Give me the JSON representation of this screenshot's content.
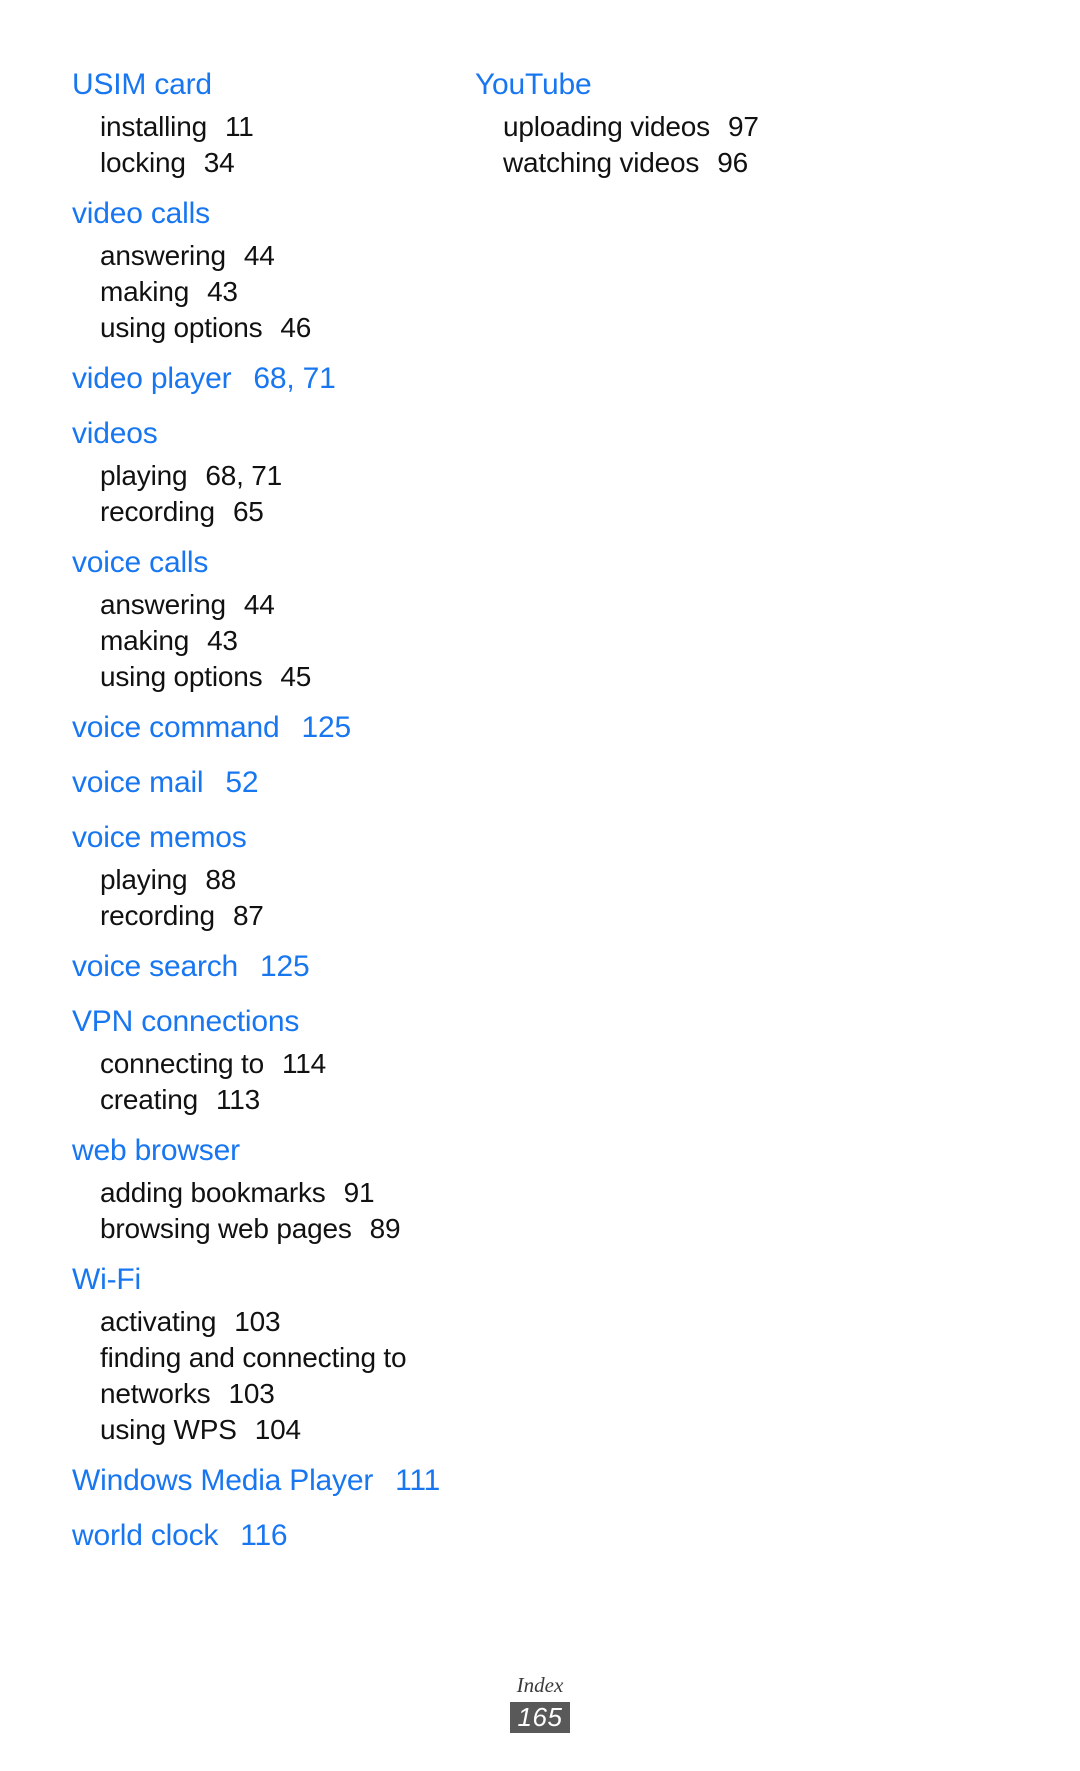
{
  "document": {
    "type": "index",
    "footer_label": "Index",
    "page_number": "165",
    "heading_color": "#1877f0",
    "text_color": "#111111",
    "badge_color": "#595959"
  },
  "columns": [
    {
      "name": "left-column",
      "groups": [
        {
          "head": "USIM card",
          "head_pages": "",
          "subentries": [
            {
              "label": "installing",
              "pages": "11"
            },
            {
              "label": "locking",
              "pages": "34"
            }
          ]
        },
        {
          "head": "video calls",
          "head_pages": "",
          "subentries": [
            {
              "label": "answering",
              "pages": "44"
            },
            {
              "label": "making",
              "pages": "43"
            },
            {
              "label": "using options",
              "pages": "46"
            }
          ]
        },
        {
          "head": "video player",
          "head_pages": "68, 71",
          "subentries": []
        },
        {
          "head": "videos",
          "head_pages": "",
          "subentries": [
            {
              "label": "playing",
              "pages": "68, 71"
            },
            {
              "label": "recording",
              "pages": "65"
            }
          ]
        },
        {
          "head": "voice calls",
          "head_pages": "",
          "subentries": [
            {
              "label": "answering",
              "pages": "44"
            },
            {
              "label": "making",
              "pages": "43"
            },
            {
              "label": "using options",
              "pages": "45"
            }
          ]
        },
        {
          "head": "voice command",
          "head_pages": "125",
          "subentries": []
        },
        {
          "head": "voice mail",
          "head_pages": "52",
          "subentries": []
        },
        {
          "head": "voice memos",
          "head_pages": "",
          "subentries": [
            {
              "label": "playing",
              "pages": "88"
            },
            {
              "label": "recording",
              "pages": "87"
            }
          ]
        },
        {
          "head": "voice search",
          "head_pages": "125",
          "subentries": []
        },
        {
          "head": "VPN connections",
          "head_pages": "",
          "subentries": [
            {
              "label": "connecting to",
              "pages": "114"
            },
            {
              "label": "creating",
              "pages": "113"
            }
          ]
        },
        {
          "head": "web browser",
          "head_pages": "",
          "subentries": [
            {
              "label": "adding bookmarks",
              "pages": "91"
            },
            {
              "label": "browsing web pages",
              "pages": "89"
            }
          ]
        },
        {
          "head": "Wi-Fi",
          "head_pages": "",
          "subentries": [
            {
              "label": "activating",
              "pages": "103"
            },
            {
              "label": "finding and connecting to",
              "pages": ""
            },
            {
              "label": "networks",
              "pages": "103",
              "continuation": true
            },
            {
              "label": "using WPS",
              "pages": "104"
            }
          ]
        },
        {
          "head": "Windows Media Player",
          "head_pages": "111",
          "subentries": []
        },
        {
          "head": "world clock",
          "head_pages": "116",
          "subentries": []
        }
      ]
    },
    {
      "name": "right-column",
      "groups": [
        {
          "head": "YouTube",
          "head_pages": "",
          "subentries": [
            {
              "label": "uploading videos",
              "pages": "97"
            },
            {
              "label": "watching videos",
              "pages": "96"
            }
          ]
        }
      ]
    }
  ]
}
